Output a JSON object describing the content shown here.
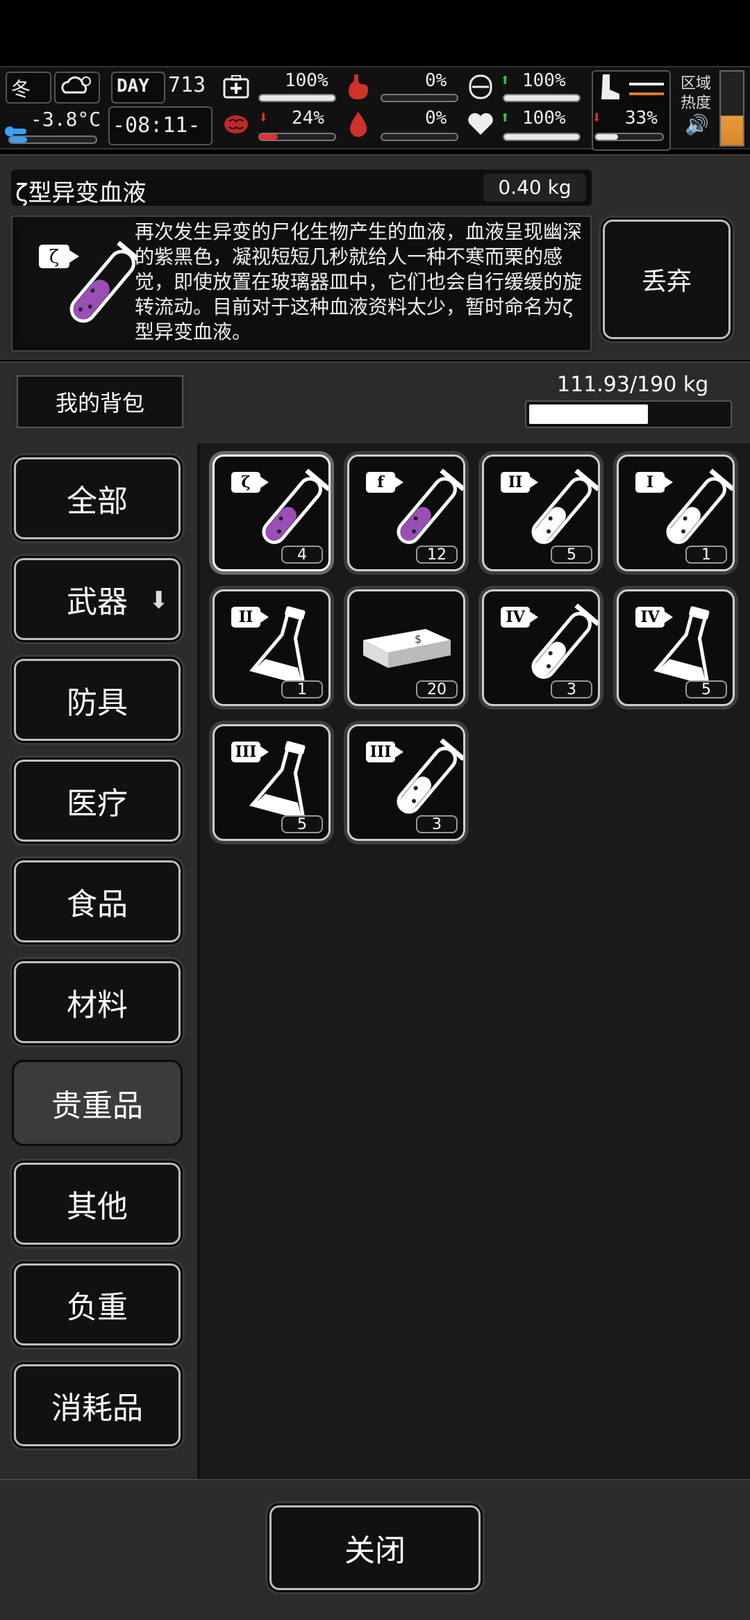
{
  "hud": {
    "season": "冬",
    "temperature": "-3.8°C",
    "day_label": "DAY",
    "day_number": "713",
    "time": "-08:11-",
    "health_pct": "100%",
    "hunger_pct": "0%",
    "armor_pct": "100%",
    "infection_pct": "24%",
    "bleed_pct": "0%",
    "mood_pct": "100%",
    "stamina_pct": "33%",
    "zone_heat_label": "区域热度",
    "bars": {
      "health": 1.0,
      "hunger": 0.0,
      "armor": 1.0,
      "infection": 0.24,
      "bleed": 0.0,
      "mood": 1.0,
      "stamina": 0.33
    }
  },
  "detail": {
    "item_name": "ζ型异变血液",
    "weight": "0.40 kg",
    "description": "再次发生异变的尸化生物产生的血液，血液呈现幽深的紫黑色，凝视短短几秒就给人一种不寒而栗的感觉，即使放置在玻璃器皿中，它们也会自行缓缓的旋转流动。目前对于这种血液资料太少，暂时命名为ζ型异变血液。",
    "icon_tag": "ζ",
    "discard_label": "丢弃"
  },
  "bag": {
    "title": "我的背包",
    "capacity": "111.93/190 kg",
    "fill": 0.589
  },
  "categories": [
    "全部",
    "武器",
    "防具",
    "医疗",
    "食品",
    "材料",
    "贵重品",
    "其他",
    "负重",
    "消耗品"
  ],
  "active_category": "贵重品",
  "items": [
    {
      "tag": "ζ",
      "kind": "tube",
      "liquid": "#9b4fb5",
      "count": "4"
    },
    {
      "tag": "f",
      "kind": "tube",
      "liquid": "#9b4fb5",
      "count": "12"
    },
    {
      "tag": "II",
      "kind": "tube",
      "liquid": "#ffffff",
      "count": "5"
    },
    {
      "tag": "I",
      "kind": "tube",
      "liquid": "#ffffff",
      "count": "1"
    },
    {
      "tag": "II",
      "kind": "flask",
      "liquid": "#ffffff",
      "count": "1"
    },
    {
      "tag": "",
      "kind": "box",
      "liquid": "#ffffff",
      "count": "20"
    },
    {
      "tag": "IV",
      "kind": "tube",
      "liquid": "#ffffff",
      "count": "3"
    },
    {
      "tag": "IV",
      "kind": "flask",
      "liquid": "#ffffff",
      "count": "5"
    },
    {
      "tag": "III",
      "kind": "flask",
      "liquid": "#ffffff",
      "count": "5"
    },
    {
      "tag": "III",
      "kind": "tube",
      "liquid": "#ffffff",
      "count": "3"
    }
  ],
  "close_label": "关闭"
}
